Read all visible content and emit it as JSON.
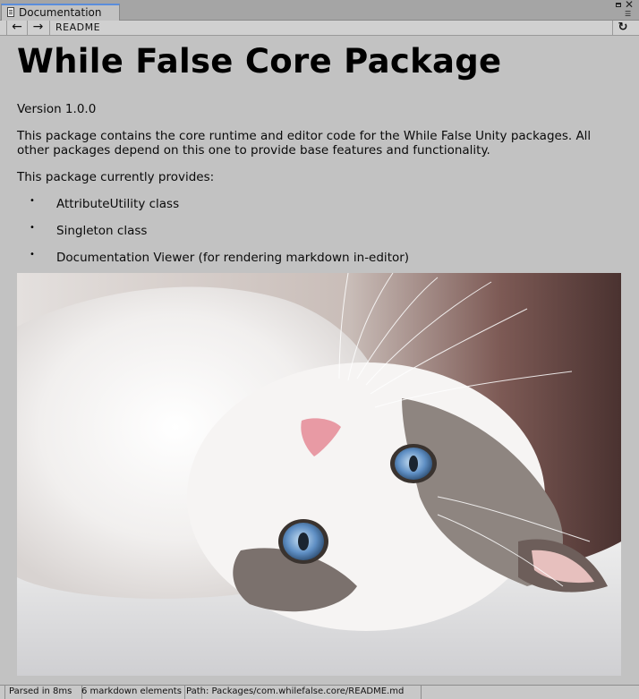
{
  "window": {
    "tab_title": "Documentation"
  },
  "toolbar": {
    "back_label": "←",
    "forward_label": "→",
    "location": "README",
    "refresh_label": "↻"
  },
  "document": {
    "title": "While False Core Package",
    "version": "Version 1.0.0",
    "description": "This package contains the core runtime and editor code for the While False Unity packages. All other packages depend on this one to provide base features and functionality.",
    "provides_intro": "This package currently provides:",
    "features": [
      "AttributeUtility class",
      "Singleton class",
      "Documentation Viewer (for rendering markdown in-editor)"
    ],
    "bullet": "•"
  },
  "statusbar": {
    "parse_time": "Parsed in 8ms",
    "element_count": "6 markdown elements",
    "path": "Path: Packages/com.whilefalse.core/README.md"
  },
  "colors": {
    "background": "#c2c2c2",
    "tab_accent": "#5a8ddc"
  }
}
